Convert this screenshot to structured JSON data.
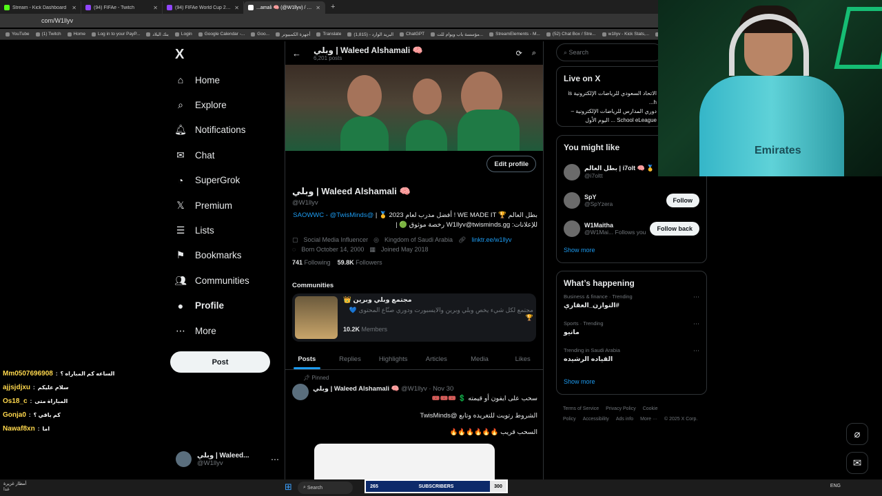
{
  "browser": {
    "tabs": [
      {
        "label": "Stream - Kick Dashboard",
        "color": "#53fc18"
      },
      {
        "label": "(94) FIFAe - Twitch",
        "color": "#9146ff"
      },
      {
        "label": "(94) FIFAe World Cup 25™ ft. R",
        "color": "#9146ff"
      },
      {
        "label": "...amali 🧠 (@W1llyv) / X | وبلي",
        "color": "#ffffff"
      }
    ],
    "url": "com/W1llyv",
    "bookmarks": [
      "YouTube",
      "(1) Twitch",
      "Home",
      "Log in to your PayP...",
      "بنك البلاد",
      "Login",
      "Google Calendar -...",
      "Goo...",
      "أجهزة الكمبيوتر",
      "Translate",
      "البريد الوارد - (1,815)",
      "ChatGPT",
      "مؤسسة باب ويوام للت...",
      "StreamElements - M...",
      "(52) Chat Box / Stre...",
      "w1llyv - Kick Stats,...",
      "Kick"
    ]
  },
  "chat": [
    {
      "user": "Mm0507696908",
      "msg": "الساعه كم المباراه ؟"
    },
    {
      "user": "ajjsjdjxu",
      "msg": "سلام عليكم"
    },
    {
      "user": "Os18_c",
      "msg": "المباراة متى"
    },
    {
      "user": "Gonja0",
      "msg": "كم باقي ؟"
    },
    {
      "user": "Nawaf8xn",
      "msg": "اما"
    }
  ],
  "nav": {
    "logo": "X",
    "items": [
      {
        "label": "Home",
        "icon": "⌂"
      },
      {
        "label": "Explore",
        "icon": "⌕"
      },
      {
        "label": "Notifications",
        "icon": "🔔︎"
      },
      {
        "label": "Chat",
        "icon": "✉"
      },
      {
        "label": "SuperGrok",
        "icon": "◔"
      },
      {
        "label": "Premium",
        "icon": "𝕏"
      },
      {
        "label": "Lists",
        "icon": "☰"
      },
      {
        "label": "Bookmarks",
        "icon": "⚑"
      },
      {
        "label": "Communities",
        "icon": "👥︎"
      },
      {
        "label": "Profile",
        "icon": "●"
      },
      {
        "label": "More",
        "icon": "⋯"
      }
    ],
    "post": "Post",
    "account": {
      "name": "وبلي | Waleed...",
      "handle": "@W1llyv"
    }
  },
  "profile": {
    "header_name": "وبلي | Waleed Alshamali 🧠",
    "posts_count": "6,201 posts",
    "edit": "Edit profile",
    "name": "وبلي | Waleed Alshamali 🧠",
    "handle": "@W1llyv",
    "bio_line1_mentions": "@SAOWWC - @TwisMinds",
    "bio_line1_text": "بطل العالم 🏆 WE MADE IT ! أفضل مدرب لعام 2023 🥇 |",
    "bio_line2": "للإعلانات: W1llyv@twisminds.gg رخصة موثوق 🟢 |",
    "category": "Social Media Influencer",
    "location": "Kingdom of Saudi Arabia",
    "link": "linktr.ee/w1llyv",
    "born": "Born October 14, 2000",
    "joined": "Joined May 2018",
    "following_count": "741",
    "following_label": "Following",
    "followers_count": "59.8K",
    "followers_label": "Followers"
  },
  "communities": {
    "heading": "Communities",
    "name": "مجتمع وبلي وبرين 👑",
    "desc": "مجتمع لكل شيء يخص وبلي وبرين والايسبورت ودوري صنّاع المحتوى 💙 🏆",
    "members_count": "10.2K",
    "members_label": "Members"
  },
  "tabs": [
    "Posts",
    "Replies",
    "Highlights",
    "Articles",
    "Media",
    "Likes"
  ],
  "tweet": {
    "pinned": "Pinned",
    "name": "وبلي | Waleed Alshamali 🧠",
    "meta": "@W1llyv · Nov 30",
    "line1": "سحب على ايفون أو قيمته 💲 🎟️🎟️🎟️",
    "line2": "الشروط رتويت للتغريده وتابع @TwisMinds",
    "line3": "السحب قريب 🔥🔥🔥🔥🔥🔥"
  },
  "right": {
    "search_placeholder": "Search",
    "live_title": "Live on X",
    "live_host": "الاتحاد السعودي للرياضات الإلكترونية is h...",
    "live_text": "دوري المدارس للرياضات الإلكترونية – School eLeague ... اليوم الأول",
    "wtf_title": "You might like",
    "wtf": [
      {
        "name": "بطل العالم | i7olt 🧠 🥇",
        "handle": "@i7oltt",
        "btn": ""
      },
      {
        "name": "SpY",
        "handle": "@SpYzera",
        "btn": "Follow"
      },
      {
        "name": "W1Maitha",
        "handle": "@W1Mai... Follows you",
        "btn": "Follow back"
      }
    ],
    "show_more": "Show more",
    "wh_title": "What’s happening",
    "trends": [
      {
        "cat": "Business & finance · Trending",
        "title": "#التوازن_العقاري"
      },
      {
        "cat": "Sports · Trending",
        "title": "ماتيو"
      },
      {
        "cat": "Trending in Saudi Arabia",
        "title": "القياده الرشيده"
      }
    ],
    "show_more2": "Show more",
    "footer": [
      "Terms of Service",
      "Privacy Policy",
      "Cookie Policy",
      "Accessibility",
      "Ads info",
      "More ···",
      "© 2025 X Corp."
    ]
  },
  "taskbar": {
    "weather": "أمطار غزيرة",
    "weather_sub": "غدا",
    "search": "Search",
    "subs_left": "265",
    "subs_label": "SUBSCRIBERS",
    "subs_right": "300",
    "lang": "ENG"
  },
  "colors": {
    "accent": "#1d9bf0",
    "bg": "#000000"
  }
}
